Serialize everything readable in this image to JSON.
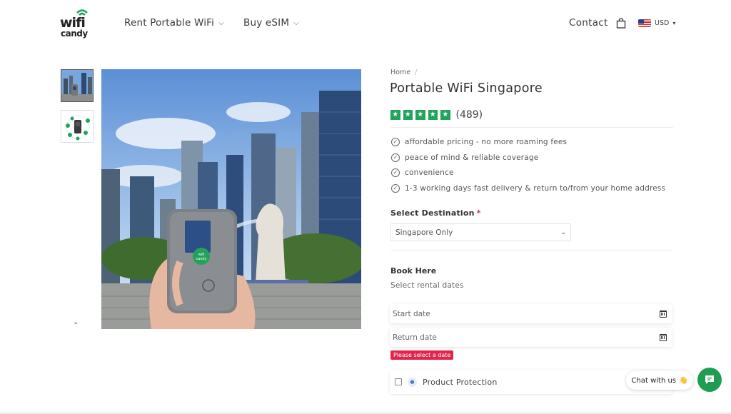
{
  "header": {
    "logo": {
      "line1": "wifi",
      "line2": "candy"
    },
    "nav": [
      {
        "label": "Rent Portable WiFi"
      },
      {
        "label": "Buy eSIM"
      }
    ],
    "contact_label": "Contact",
    "currency": "USD",
    "icons": {
      "bag": "shopping-bag-icon",
      "flag": "us-flag-icon",
      "chevron": "chevron-down-icon"
    }
  },
  "gallery": {
    "thumbnails": [
      "singapore-photo-thumbnail",
      "device-infographic-thumbnail"
    ],
    "device_screen_logo": {
      "line1": "wifi",
      "line2": "candy"
    }
  },
  "product": {
    "breadcrumb": [
      "Home"
    ],
    "breadcrumb_separator": "/",
    "title": "Portable WiFi Singapore",
    "rating": {
      "stars": 5,
      "count": "(489)",
      "color": "#21a35a"
    },
    "features": [
      "affordable pricing - no more roaming fees",
      "peace of mind & reliable coverage",
      "convenience",
      "1-3 working days fast delivery & return to/from your home address"
    ],
    "destination": {
      "label": "Select Destination",
      "required_mark": "*",
      "selected": "Singapore Only"
    },
    "booking": {
      "title": "Book Here",
      "subtitle": "Select rental dates",
      "start_placeholder": "Start date",
      "return_placeholder": "Return date",
      "error": "Please select a date"
    },
    "protection_label": "Product Protection"
  },
  "chat": {
    "label": "Chat with us",
    "emoji": "👋",
    "accent": "#1f9d50"
  },
  "colors": {
    "brand_green": "#21a35a",
    "error_red": "#e0254a"
  }
}
